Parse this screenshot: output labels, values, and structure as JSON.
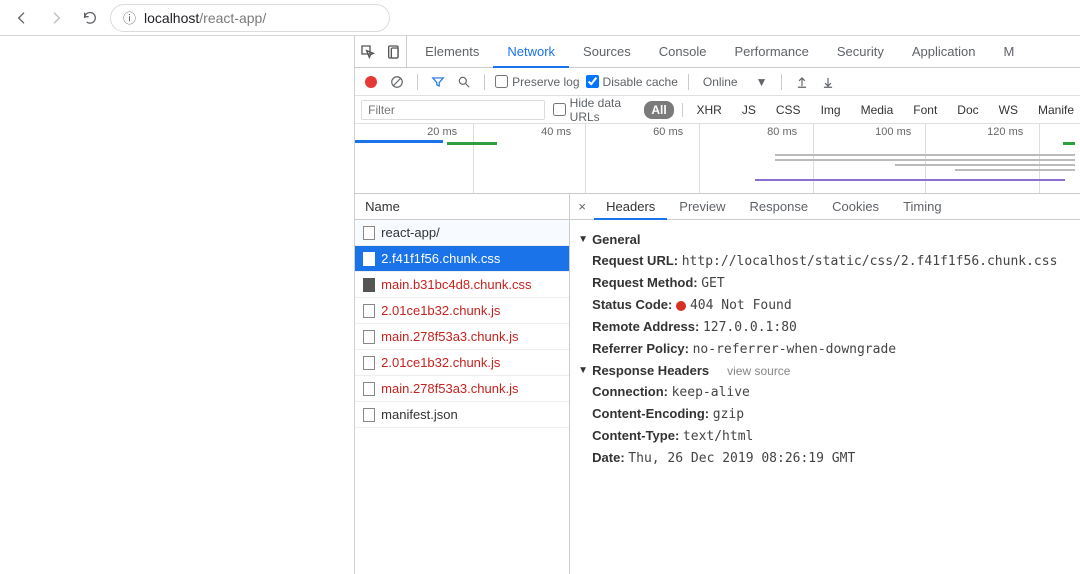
{
  "browser": {
    "url_host": "localhost",
    "url_path": "/react-app/"
  },
  "devtools": {
    "tabs": [
      "Elements",
      "Network",
      "Sources",
      "Console",
      "Performance",
      "Security",
      "Application",
      "M"
    ],
    "active_tab": "Network",
    "toolbar": {
      "preserve_log": "Preserve log",
      "disable_cache": "Disable cache",
      "throttle": "Online"
    },
    "filter": {
      "placeholder": "Filter",
      "hide_urls": "Hide data URLs",
      "types": [
        "All",
        "XHR",
        "JS",
        "CSS",
        "Img",
        "Media",
        "Font",
        "Doc",
        "WS",
        "Manife"
      ]
    },
    "timeline": {
      "ticks": [
        "20 ms",
        "40 ms",
        "60 ms",
        "80 ms",
        "100 ms",
        "120 ms"
      ]
    },
    "list_header": "Name",
    "requests": [
      {
        "name": "react-app/",
        "class": "light"
      },
      {
        "name": "2.f41f1f56.chunk.css",
        "class": "selected css"
      },
      {
        "name": "main.b31bc4d8.chunk.css",
        "class": "red css"
      },
      {
        "name": "2.01ce1b32.chunk.js",
        "class": "red"
      },
      {
        "name": "main.278f53a3.chunk.js",
        "class": "red"
      },
      {
        "name": "2.01ce1b32.chunk.js",
        "class": "red"
      },
      {
        "name": "main.278f53a3.chunk.js",
        "class": "red"
      },
      {
        "name": "manifest.json",
        "class": ""
      }
    ],
    "detail_tabs": [
      "Headers",
      "Preview",
      "Response",
      "Cookies",
      "Timing"
    ],
    "detail_active": "Headers",
    "general": {
      "title": "General",
      "request_url_k": "Request URL:",
      "request_url_v": "http://localhost/static/css/2.f41f1f56.chunk.css",
      "request_method_k": "Request Method:",
      "request_method_v": "GET",
      "status_code_k": "Status Code:",
      "status_code_v": "404 Not Found",
      "remote_addr_k": "Remote Address:",
      "remote_addr_v": "127.0.0.1:80",
      "referrer_k": "Referrer Policy:",
      "referrer_v": "no-referrer-when-downgrade"
    },
    "response_headers": {
      "title": "Response Headers",
      "view_source": "view source",
      "connection_k": "Connection:",
      "connection_v": "keep-alive",
      "encoding_k": "Content-Encoding:",
      "encoding_v": "gzip",
      "ctype_k": "Content-Type:",
      "ctype_v": "text/html",
      "date_k": "Date:",
      "date_v": "Thu, 26 Dec 2019 08:26:19 GMT"
    }
  }
}
